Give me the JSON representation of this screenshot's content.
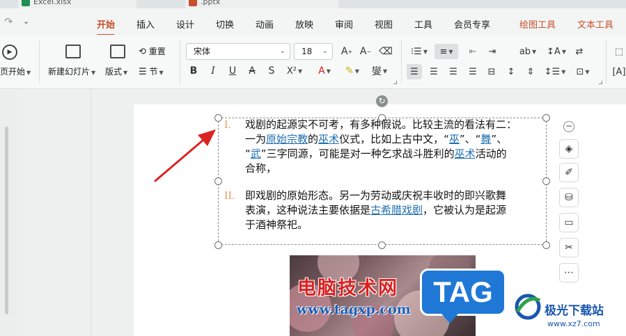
{
  "file_tabs": [
    {
      "label": "Excel.xlsx",
      "color": "#1e8f4e"
    },
    {
      "label": ".pptx",
      "color": "#c8502c"
    }
  ],
  "menu": {
    "undo_icon": "redo-icon",
    "items": [
      "开始",
      "插入",
      "设计",
      "切换",
      "动画",
      "放映",
      "审阅",
      "视图",
      "工具",
      "会员专享",
      "绘图工具",
      "文本工具"
    ],
    "active": "开始",
    "contextual": [
      "绘图工具",
      "文本工具"
    ],
    "accent": "#c8502c"
  },
  "ribbon": {
    "play_from_start": "页开始",
    "new_slide": "新建幻灯片",
    "layout": "版式",
    "reset": "重置",
    "section": "节",
    "font_name": "宋体",
    "font_size": "18"
  },
  "slide": {
    "paragraphs": [
      {
        "numeral": "I.",
        "lines": [
          [
            {
              "t": "戏剧的起源实不可考，有多种假说。比较主流的看法有二："
            }
          ],
          [
            {
              "t": "一为"
            },
            {
              "t": "原始宗教",
              "link": true
            },
            {
              "t": "的"
            },
            {
              "t": "巫术",
              "link": true
            },
            {
              "t": "仪式，比如上古中文，“"
            },
            {
              "t": "巫",
              "link": true
            },
            {
              "t": "”、“"
            },
            {
              "t": "舞",
              "link": true
            },
            {
              "t": "”、"
            }
          ],
          [
            {
              "t": "“"
            },
            {
              "t": "武",
              "link": true
            },
            {
              "t": "”三字同源，可能是对一种乞求战斗胜利的"
            },
            {
              "t": "巫术",
              "link": true
            },
            {
              "t": "活动的"
            }
          ],
          [
            {
              "t": "合称，"
            }
          ]
        ]
      },
      {
        "numeral": "II.",
        "lines": [
          [
            {
              "t": "即戏剧的原始形态。另一为劳动或庆祝丰收时的即兴歌舞"
            }
          ],
          [
            {
              "t": "表演，这种说法主要依据是"
            },
            {
              "t": "古希腊戏剧",
              "link": true
            },
            {
              "t": "，它被认为是起源"
            }
          ],
          [
            {
              "t": "于酒神祭祀。"
            }
          ]
        ]
      }
    ]
  },
  "watermark": {
    "cn": "电脑技术网",
    "url": "www.tagxp.com",
    "tag": "TAG",
    "logo_cn": "极光下载站",
    "logo_url": "www.xz7.com"
  }
}
